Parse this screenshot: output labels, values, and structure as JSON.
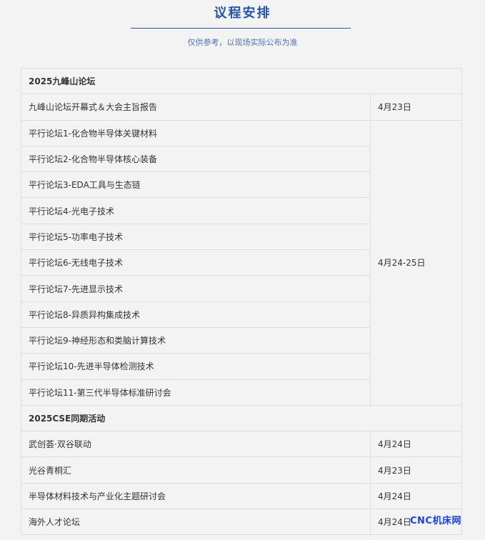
{
  "header": {
    "title": "议程安排",
    "subtitle": "仅供参考，以现场实际公布为准"
  },
  "sections": [
    {
      "name": "2025九峰山论坛",
      "rows": [
        {
          "name": "九峰山论坛开幕式＆大会主旨报告",
          "date": "4月23日"
        },
        {
          "name": "平行论坛1-化合物半导体关键材料",
          "date": "4月24-25日"
        },
        {
          "name": "平行论坛2-化合物半导体核心装备"
        },
        {
          "name": "平行论坛3-EDA工具与生态链"
        },
        {
          "name": "平行论坛4-光电子技术"
        },
        {
          "name": "平行论坛5-功率电子技术"
        },
        {
          "name": "平行论坛6-无线电子技术"
        },
        {
          "name": "平行论坛7-先进显示技术"
        },
        {
          "name": "平行论坛8-异质异构集成技术"
        },
        {
          "name": "平行论坛9-神经形态和类脑计算技术"
        },
        {
          "name": "平行论坛10-先进半导体检测技术"
        },
        {
          "name": "平行论坛11-第三代半导体标准研讨会"
        }
      ]
    },
    {
      "name": "2025CSE同期活动",
      "rows": [
        {
          "name": "武创荟·双谷联动",
          "date": "4月24日"
        },
        {
          "name": "光谷青桐汇",
          "date": "4月23日"
        },
        {
          "name": "半导体材料技术与产业化主题研讨会",
          "date": "4月24日"
        },
        {
          "name": "海外人才论坛",
          "date": "4月24日"
        }
      ]
    }
  ],
  "watermark": "CNC机床网"
}
